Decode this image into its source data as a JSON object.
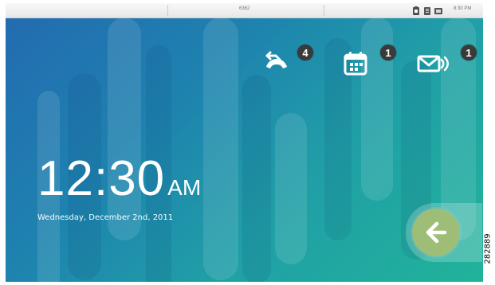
{
  "status_bar": {
    "center_text": "6362",
    "time": "8:30 PM",
    "icons": [
      "battery-icon",
      "signal-icon",
      "network-icon"
    ]
  },
  "notifications": [
    {
      "name": "missed-call",
      "icon": "phone-missed-call-icon",
      "count": "4"
    },
    {
      "name": "calendar",
      "icon": "calendar-icon",
      "count": "1"
    },
    {
      "name": "voicemail",
      "icon": "voicemail-icon",
      "count": "1"
    }
  ],
  "clock": {
    "time": "12:30",
    "ampm": "AM",
    "date": "Wednesday, December 2nd, 2011"
  },
  "navigation": {
    "back_icon": "arrow-left-icon"
  },
  "figure": {
    "id": "282889"
  },
  "colors": {
    "screen_blue": "#236ab0",
    "screen_teal": "#21b39a",
    "badge_background": "#3a3a3a",
    "back_button_green": "#9ebe77",
    "status_bar_background": "#efefef"
  }
}
